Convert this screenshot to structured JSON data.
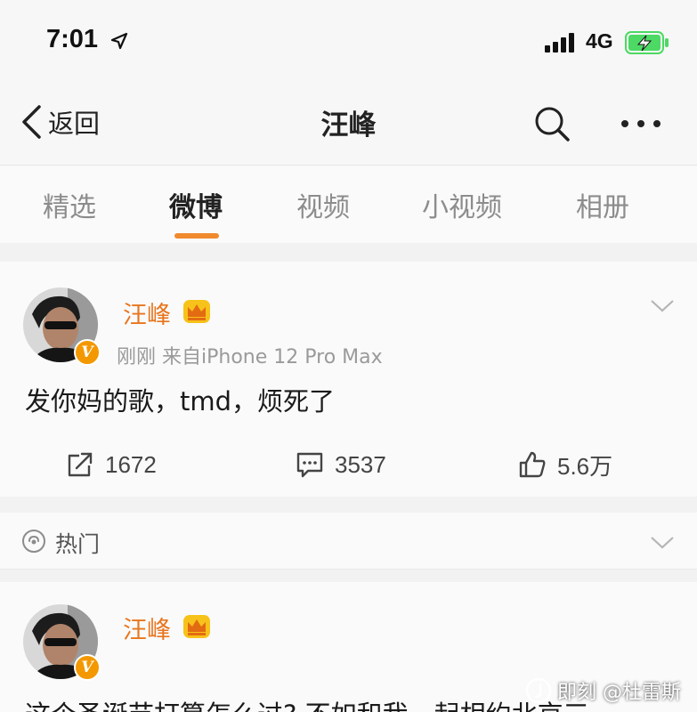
{
  "status_bar": {
    "time": "7:01",
    "network": "4G"
  },
  "nav": {
    "back_label": "返回",
    "title": "汪峰"
  },
  "tabs": [
    {
      "label": "精选",
      "active": false
    },
    {
      "label": "微博",
      "active": true
    },
    {
      "label": "视频",
      "active": false
    },
    {
      "label": "小视频",
      "active": false
    },
    {
      "label": "相册",
      "active": false
    }
  ],
  "post": {
    "author": "汪峰",
    "time": "刚刚",
    "source": "来自iPhone 12 Pro Max",
    "text": "发你妈的歌，tmd，烦死了",
    "reposts": "1672",
    "comments": "3537",
    "likes": "5.6万"
  },
  "hot_section": {
    "label": "热门"
  },
  "hot_post": {
    "author": "汪峰",
    "text": "这个圣诞节打算怎么过? 不如和我一起相约北京三"
  },
  "watermark": {
    "text": "即刻 @杜雷斯"
  },
  "colors": {
    "accent": "#f08a2d",
    "name": "#e8761e",
    "verified": "#f39800",
    "battery": "#4cd964"
  }
}
